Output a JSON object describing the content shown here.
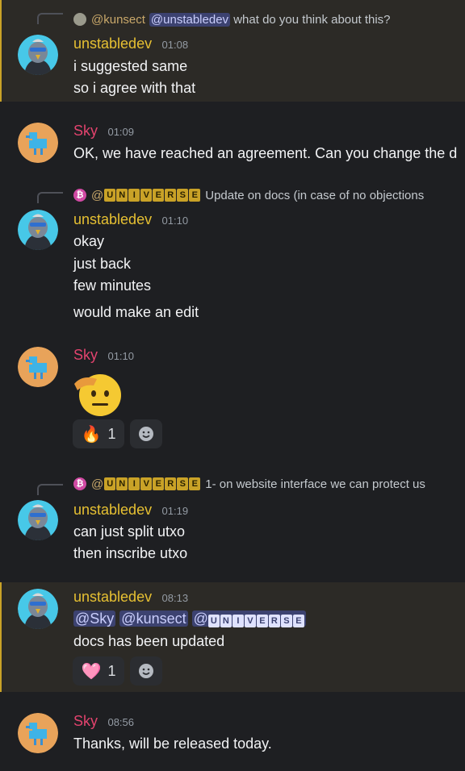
{
  "colors": {
    "background": "#1e1f22",
    "highlight": "#2c2a26",
    "unstabledev": "#e6c032",
    "sky": "#e3436e",
    "mention_bg": "#3c4270"
  },
  "messages": [
    {
      "reply": {
        "author": "@kunsect",
        "mention": "@unstabledev",
        "text": " what do you think about this?"
      },
      "author": "unstabledev",
      "time": "01:08",
      "lines": [
        "i suggested same",
        "so i agree with that"
      ]
    },
    {
      "author": "Sky",
      "time": "01:09",
      "lines": [
        "OK, we have reached an agreement. Can you change the d"
      ]
    },
    {
      "reply": {
        "author_prefix": "@",
        "author_letters": [
          "U",
          "N",
          "I",
          "V",
          "E",
          "R",
          "S",
          "E"
        ],
        "text": "Update on docs (in case of no objections"
      },
      "author": "unstabledev",
      "time": "01:10",
      "lines": [
        "okay",
        "just back",
        "few minutes",
        "would make an edit"
      ]
    },
    {
      "author": "Sky",
      "time": "01:10",
      "emoji": "salute-face",
      "reactions": [
        {
          "emoji": "🔥",
          "count": "1"
        }
      ]
    },
    {
      "reply": {
        "author_prefix": "@",
        "author_letters": [
          "U",
          "N",
          "I",
          "V",
          "E",
          "R",
          "S",
          "E"
        ],
        "text": "1- on website interface we can protect us"
      },
      "author": "unstabledev",
      "time": "01:19",
      "lines": [
        "can just split utxo",
        "then inscribe utxo"
      ]
    },
    {
      "author": "unstabledev",
      "time": "08:13",
      "mentions": [
        "@Sky",
        "@kunsect",
        "@"
      ],
      "mention_letters": [
        "U",
        "N",
        "I",
        "V",
        "E",
        "R",
        "S",
        "E"
      ],
      "lines": [
        "docs has been updated"
      ],
      "reactions": [
        {
          "emoji": "🩷",
          "count": "1"
        }
      ]
    },
    {
      "author": "Sky",
      "time": "08:56",
      "lines": [
        "Thanks, will be released today."
      ]
    }
  ]
}
